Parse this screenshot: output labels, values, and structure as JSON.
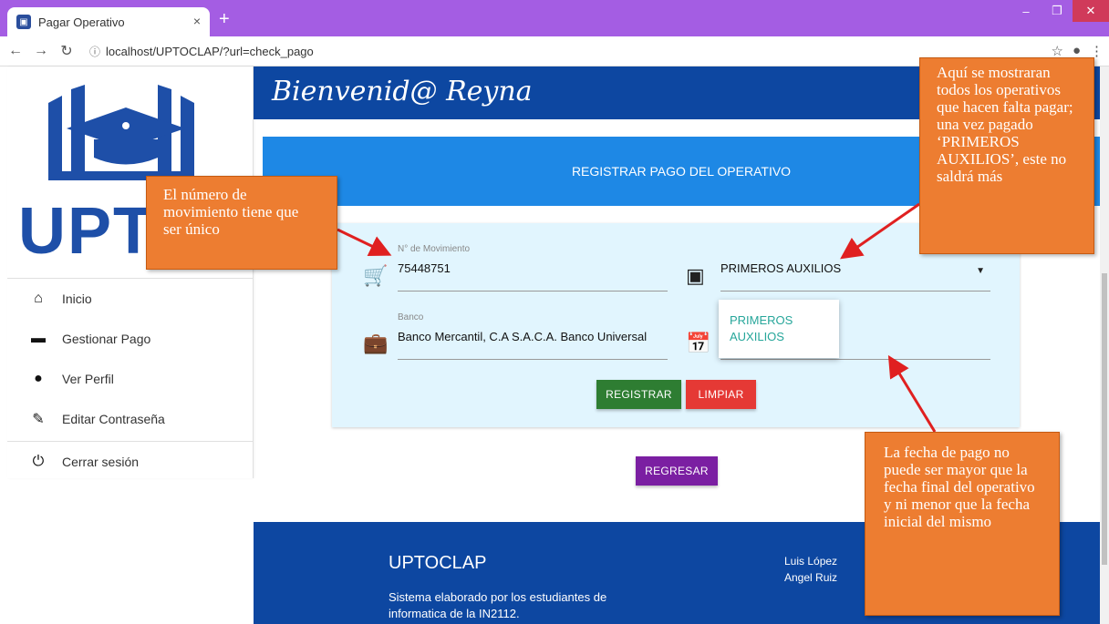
{
  "browser": {
    "tab_title": "Pagar Operativo",
    "tab_close": "×",
    "new_tab": "+",
    "address": "localhost/UPTOCLAP/?url=check_pago",
    "min": "–",
    "restore": "❐",
    "close": "✕"
  },
  "sidebar": {
    "logo_text": "UPTA",
    "items": [
      {
        "label": "Inicio",
        "icon": "home-icon",
        "glyph": "⌂"
      },
      {
        "label": "Gestionar Pago",
        "icon": "briefcase-icon",
        "glyph": "▬"
      },
      {
        "label": "Ver Perfil",
        "icon": "person-icon",
        "glyph": "●"
      },
      {
        "label": "Editar Contraseña",
        "icon": "pencil-icon",
        "glyph": "✎"
      },
      {
        "label": "Cerrar sesión",
        "icon": "power-icon",
        "glyph": "⏻"
      }
    ]
  },
  "header": {
    "welcome": "Bienvenid@ Reyna"
  },
  "banner": {
    "title": "REGISTRAR PAGO DEL OPERATIVO"
  },
  "form": {
    "movimiento_label": "N° de Movimiento",
    "movimiento_value": "75448751",
    "operativo_value": "PRIMEROS AUXILIOS",
    "banco_label": "Banco",
    "banco_value": "Banco Mercantil, C.A S.A.C.A. Banco Universal",
    "dropdown_option": "PRIMEROS AUXILIOS",
    "register": "REGISTRAR",
    "clear": "LIMPIAR",
    "back": "REGRESAR"
  },
  "footer": {
    "title": "UPTOCLAP",
    "desc": "Sistema elaborado por los estudiantes de informatica de la IN2112.",
    "name1": "Luis López",
    "name2": "Angel Ruiz"
  },
  "callouts": {
    "c1": "El número de movimiento tiene que ser único",
    "c2": "Aquí se mostraran todos los operativos que hacen falta pagar; una vez pagado ‘PRIMEROS AUXILIOS’, este no saldrá más",
    "c3": "La fecha de pago no puede ser mayor que la fecha final del operativo y ni menor que la fecha inicial del mismo"
  },
  "colors": {
    "header": "#0d47a1",
    "banner": "#1e88e5",
    "callout": "#ed7d31",
    "tabbar": "#a45de3"
  }
}
